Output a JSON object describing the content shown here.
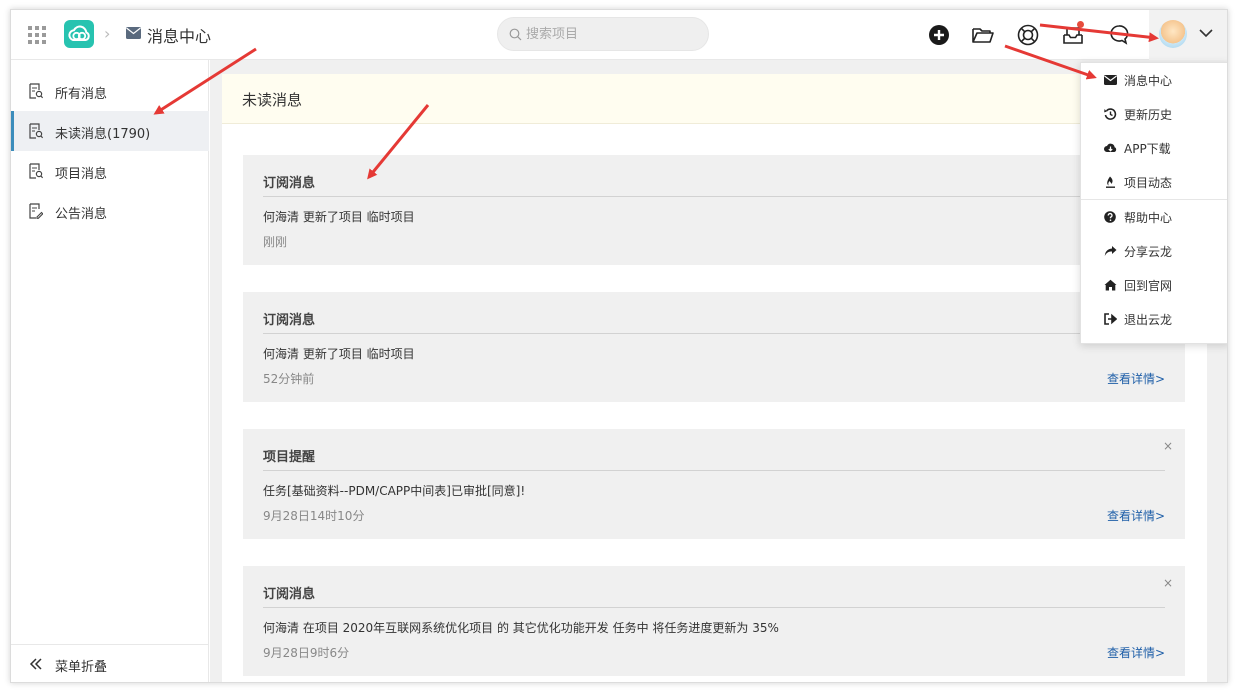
{
  "header": {
    "breadcrumb_title": "消息中心",
    "search_placeholder": "搜索项目"
  },
  "sidebar": {
    "items": [
      {
        "label": "所有消息"
      },
      {
        "label": "未读消息(1790)"
      },
      {
        "label": "项目消息"
      },
      {
        "label": "公告消息"
      }
    ],
    "collapse_label": "菜单折叠"
  },
  "main": {
    "panel_title": "未读消息",
    "cards": [
      {
        "type": "订阅消息",
        "text": "何海清 更新了项目 临时项目",
        "time": "刚刚",
        "detail": "",
        "close": ""
      },
      {
        "type": "订阅消息",
        "text": "何海清 更新了项目 临时项目",
        "time": "52分钟前",
        "detail": "查看详情>",
        "close": ""
      },
      {
        "type": "项目提醒",
        "text": "任务[基础资料--PDM/CAPP中间表]已审批[同意]!",
        "time": "9月28日14时10分",
        "detail": "查看详情>",
        "close": "×"
      },
      {
        "type": "订阅消息",
        "text": "何海清 在项目 2020年互联网系统优化项目 的 其它优化功能开发 任务中 将任务进度更新为 35%",
        "time": "9月28日9时6分",
        "detail": "查看详情>",
        "close": "×"
      }
    ]
  },
  "dropdown": {
    "items": [
      {
        "label": "消息中心",
        "icon": "envelope-icon"
      },
      {
        "label": "更新历史",
        "icon": "history-icon"
      },
      {
        "label": "APP下载",
        "icon": "cloud-download-icon"
      },
      {
        "label": "项目动态",
        "icon": "fire-icon"
      },
      {
        "label": "帮助中心",
        "icon": "question-icon"
      },
      {
        "label": "分享云龙",
        "icon": "share-icon"
      },
      {
        "label": "回到官网",
        "icon": "home-icon"
      },
      {
        "label": "退出云龙",
        "icon": "sign-out-icon"
      }
    ]
  },
  "colors": {
    "brand": "#27c3b0",
    "link": "#1f5fa8",
    "annotation_arrow": "#e53935",
    "active_bar": "#3c8dbc"
  }
}
